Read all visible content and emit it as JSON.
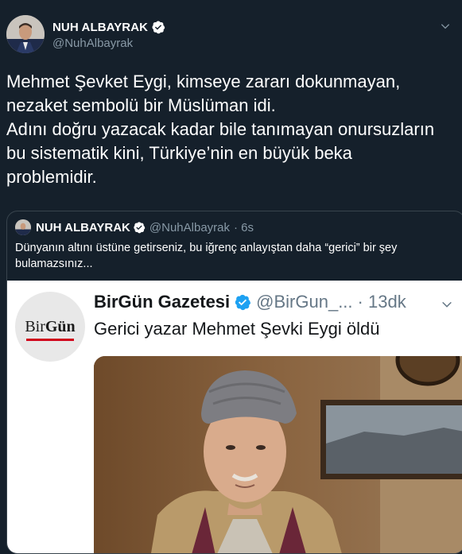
{
  "author": {
    "name": "NUH ALBAYRAK",
    "handle": "@NuhAlbayrak"
  },
  "tweet": {
    "text": "Mehmet Şevket Eygi, kimseye zararı dokunmayan,\nnezaket sembolü bir Müslüman idi.\nAdını doğru yazacak kadar bile tanımayan onursuzların\nbu sistematik kini, Türkiye’nin en büyük beka\nproblemidir."
  },
  "quoted": {
    "name": "NUH ALBAYRAK",
    "handle": "@NuhAlbayrak",
    "time": "· 6s",
    "text": "Dünyanın altını üstüne getirseniz, bu iğrenç anlayıştan daha “gerici” bir şey bulamazsınız...",
    "embedded": {
      "logo_prefix": "Bir",
      "logo_suffix": "Gün",
      "name": "BirGün Gazetesi",
      "handle": "@BirGun_...",
      "time": "· 13dk",
      "text": "Gerici yazar Mehmet Şevki Eygi öldü"
    }
  },
  "icons": {
    "verified": "verified-badge-icon",
    "more": "chevron-down-icon"
  },
  "colors": {
    "background": "#15202b",
    "secondary_text": "#8899a6",
    "verified": "#1da1f2",
    "border": "#38444d",
    "brand_red": "#d0021b"
  }
}
